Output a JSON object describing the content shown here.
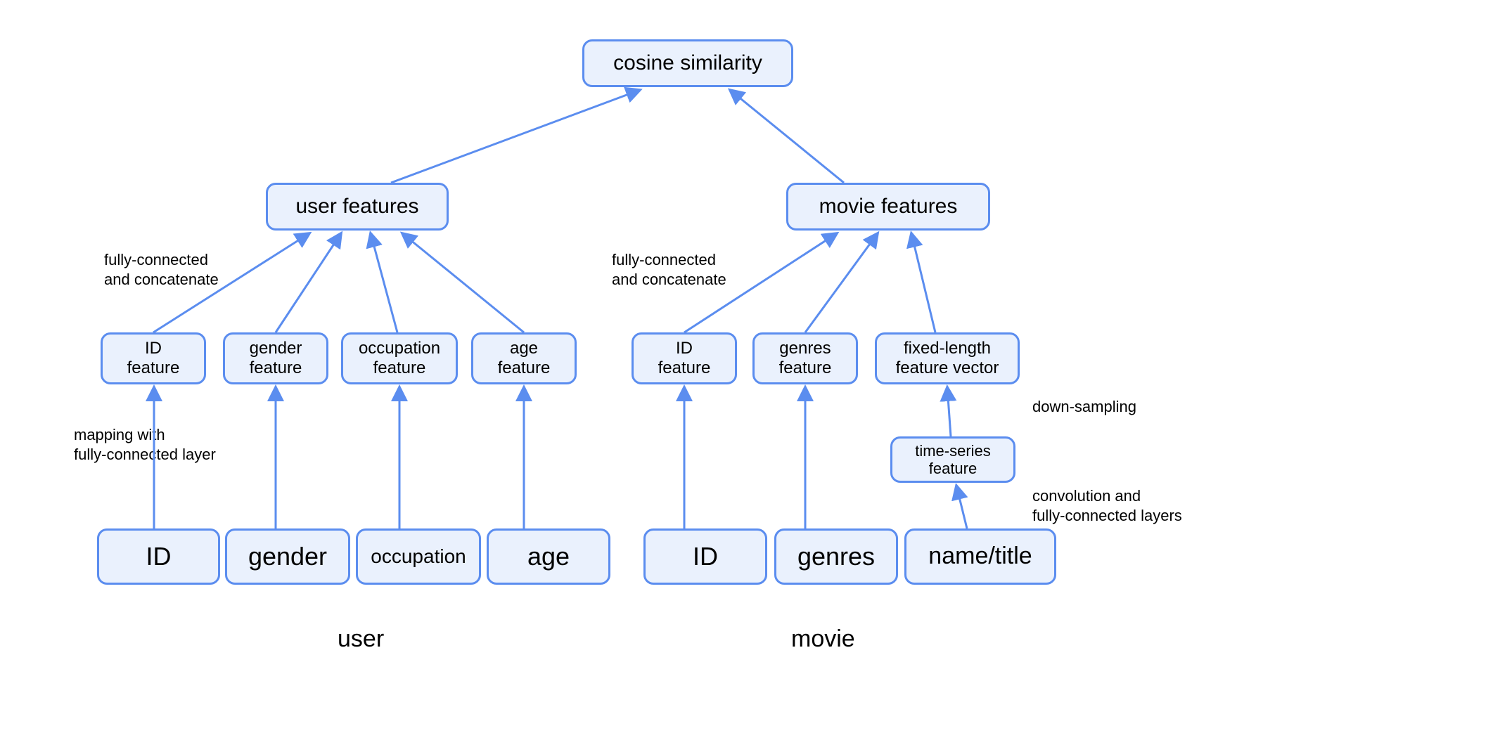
{
  "diagram": {
    "top": {
      "cosine": "cosine similarity"
    },
    "user": {
      "features": "user features",
      "id_feat": "ID\nfeature",
      "gender_feat": "gender\nfeature",
      "occ_feat": "occupation\nfeature",
      "age_feat": "age\nfeature",
      "id": "ID",
      "gender": "gender",
      "occupation": "occupation",
      "age": "age",
      "title": "user"
    },
    "movie": {
      "features": "movie features",
      "id_feat": "ID\nfeature",
      "genres_feat": "genres\nfeature",
      "fixed_feat": "fixed-length\nfeature vector",
      "ts_feat": "time-series\nfeature",
      "id": "ID",
      "genres": "genres",
      "name": "name/title",
      "title": "movie"
    },
    "annot": {
      "fc_concat_left": "fully-connected\nand concatenate",
      "fc_concat_right": "fully-connected\nand concatenate",
      "mapping": "mapping with\nfully-connected layer",
      "down": "down-sampling",
      "conv": "convolution and\nfully-connected layers"
    }
  },
  "colors": {
    "stroke": "#5b8def",
    "fill": "#eaf1fd"
  }
}
